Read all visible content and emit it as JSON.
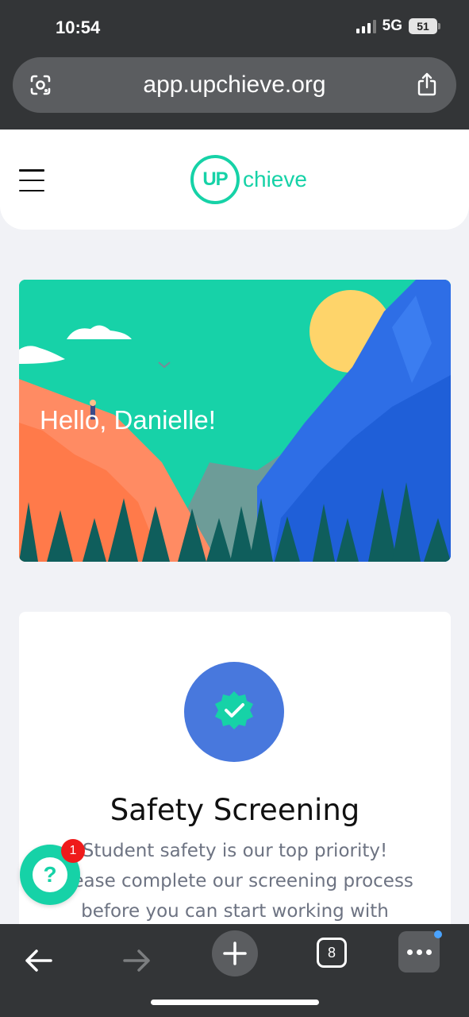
{
  "status_bar": {
    "time": "10:54",
    "network": "5G",
    "battery": "51"
  },
  "browser": {
    "url": "app.upchieve.org",
    "lens_icon": "google-lens-icon",
    "share_icon": "share-icon"
  },
  "app_header": {
    "menu_icon": "hamburger-menu-icon",
    "logo": {
      "circle_text": "UP",
      "rest_text": "chieve"
    }
  },
  "hero": {
    "greeting": "Hello, Danielle!"
  },
  "safety_card": {
    "icon": "verified-badge-icon",
    "title": "Safety Screening",
    "body_line_1": "Student safety is our top priority!",
    "body_line_2": "Please complete our screening process",
    "body_line_3": "before you can start working with"
  },
  "help_widget": {
    "icon": "question-mark-icon",
    "badge_count": "1"
  },
  "bottom_toolbar": {
    "back_icon": "back-arrow-icon",
    "forward_icon": "forward-arrow-icon",
    "new_tab_icon": "plus-icon",
    "tab_count": "8",
    "more_icon": "more-dots-icon"
  },
  "colors": {
    "brand_green": "#16d2a7",
    "badge_blue": "#4878dd",
    "notification_red": "#ef1b1b"
  }
}
